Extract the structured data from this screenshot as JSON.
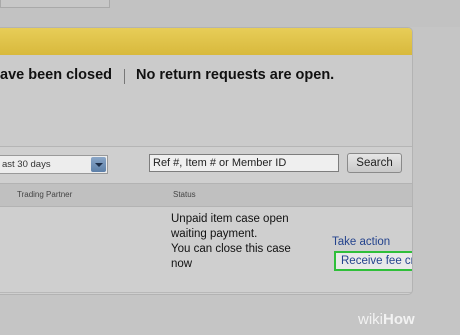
{
  "summary": {
    "closed_text": "ave been closed",
    "open_text": "No return requests are open."
  },
  "filters": {
    "date_range": "ast 30 days",
    "search_placeholder": "Ref #, Item # or Member ID",
    "search_button": "Search"
  },
  "table": {
    "headers": [
      "Trading Partner",
      "Status"
    ],
    "row": {
      "status_lines": [
        "Unpaid item case open",
        "waiting payment.",
        "You can close this case",
        "now"
      ],
      "actions": [
        "Take action",
        "Receive fee credit"
      ]
    }
  },
  "colors": {
    "banner": "#e2c54d",
    "link": "#24438d",
    "highlight": "#2fbf3a"
  },
  "watermark": {
    "wiki": "wiki",
    "how": "How"
  }
}
